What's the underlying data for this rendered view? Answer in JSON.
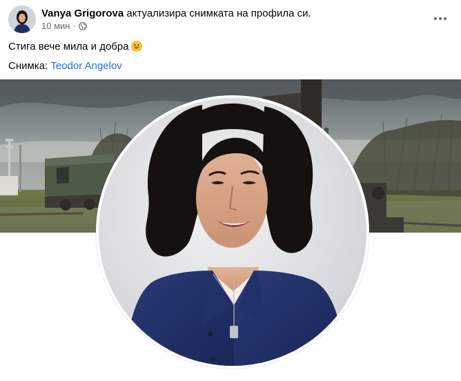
{
  "post": {
    "author_name": "Vanya Grigorova",
    "action_text": "актуализира снимката на профила си.",
    "timestamp": "10 мин",
    "separator": "·",
    "privacy_icon": "globe-icon",
    "more_icon": "more-horizontal-icon",
    "text": "Стига вече мила и добра",
    "emoji": "grinning-face-emoji",
    "credit_label": "Снимка:",
    "credit_name": "Teodor Angelov"
  },
  "colors": {
    "text_primary": "#050505",
    "text_secondary": "#65676b",
    "link": "#216fdb",
    "background": "#ffffff"
  },
  "images": {
    "cover_photo": "cover-photo-old-locomotives",
    "profile_photo": "profile-photo-woman-blue-blazer"
  }
}
